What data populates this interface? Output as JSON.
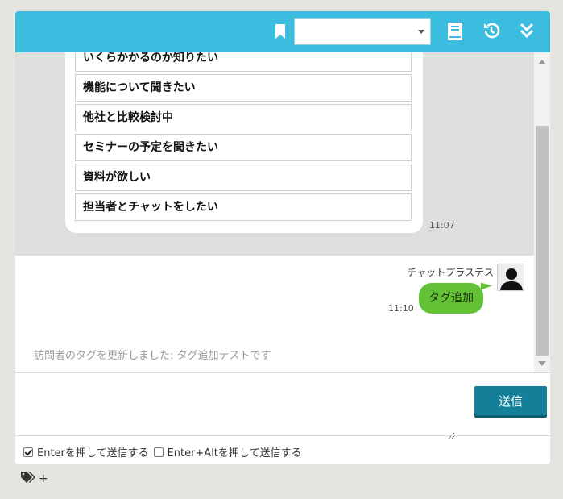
{
  "header": {
    "select_value": ""
  },
  "chat": {
    "options": [
      "いくらかかるのか知りたい",
      "機能について聞きたい",
      "他社と比較検討中",
      "セミナーの予定を聞きたい",
      "資料が欲しい",
      "担当者とチャットをしたい"
    ],
    "bot_time": "11:07",
    "sender_name": "チャットプラステスト",
    "user_message": "タグ追加",
    "user_time": "11:10",
    "system_message": "訪問者のタグを更新しました: タグ追加テストです"
  },
  "composer": {
    "input_value": "",
    "send_label": "送信",
    "enter_send_label": "Enterを押して送信する",
    "enter_alt_send_label": "Enter+Altを押して送信する",
    "enter_send_checked": true,
    "enter_alt_send_checked": false
  },
  "tags": {
    "add_label": "+"
  },
  "colors": {
    "header": "#3cbde0",
    "send_button": "#137f99",
    "user_bubble": "#62c134"
  }
}
